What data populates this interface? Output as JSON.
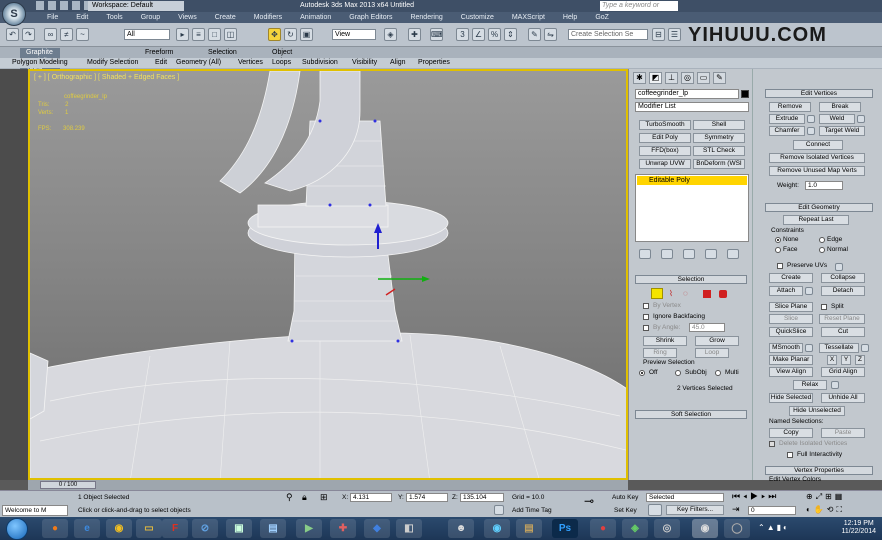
{
  "titlebar": {
    "workspace": "Workspace: Default",
    "title": "Autodesk 3ds Max 2013 x64      Untitled",
    "search_placeholder": "Type a keyword or phrase"
  },
  "menu": [
    "File",
    "Edit",
    "Tools",
    "Group",
    "Views",
    "Create",
    "Modifiers",
    "Animation",
    "Graph Editors",
    "Rendering",
    "Customize",
    "MAXScript",
    "Help",
    "GoZ"
  ],
  "toolbar": {
    "filter": "All",
    "view": "View",
    "selection_set": "Create Selection Se",
    "brand": "YIHUUU.COM"
  },
  "ribbon": {
    "tabs": [
      "Graphite Modeling Tools",
      "Freeform",
      "Selection",
      "Object Paint"
    ],
    "sub": [
      "Polygon Modeling",
      "Modify Selection",
      "Edit",
      "Geometry (All)",
      "Vertices",
      "Loops",
      "Subdivision",
      "Visibility",
      "Align",
      "Properties"
    ]
  },
  "viewport": {
    "label": "[ + ] [ Orthographic ] [ Shaded + Edged Faces ]",
    "object": "coffeegrinder_lp",
    "tris_label": "Tris:",
    "tris": "2",
    "verts_label": "Verts:",
    "verts": "1",
    "fps_label": "FPS:",
    "fps": "308.239"
  },
  "command_panel": {
    "object_name": "coffeegrinder_lp",
    "modifier_list": "Modifier List",
    "mod_buttons": [
      "TurboSmooth",
      "Shell",
      "Edit Poly",
      "Symmetry",
      "FFD(box)",
      "STL Check",
      "Unwrap UVW",
      "BnDeform (WSI"
    ],
    "stack_item": "Editable Poly",
    "selection": {
      "header": "Selection",
      "by_vertex": "By Vertex",
      "ignore_backfacing": "Ignore Backfacing",
      "by_angle": "By Angle:",
      "angle_val": "45.0",
      "shrink": "Shrink",
      "grow": "Grow",
      "ring": "Ring",
      "loop": "Loop",
      "preview": "Preview Selection",
      "off": "Off",
      "subobj": "SubObj",
      "multi": "Multi",
      "status": "2 Vertices Selected"
    },
    "soft_selection": "Soft Selection"
  },
  "edit_vertices": {
    "header": "Edit Vertices",
    "remove": "Remove",
    "break": "Break",
    "extrude": "Extrude",
    "weld": "Weld",
    "chamfer": "Chamfer",
    "target_weld": "Target Weld",
    "connect": "Connect",
    "remove_isolated": "Remove Isolated Vertices",
    "remove_unused": "Remove Unused Map Verts",
    "weight_label": "Weight:",
    "weight": "1.0"
  },
  "edit_geometry": {
    "header": "Edit Geometry",
    "repeat_last": "Repeat Last",
    "constraints": "Constraints",
    "none": "None",
    "edge": "Edge",
    "face": "Face",
    "normal": "Normal",
    "preserve_uvs": "Preserve UVs",
    "create": "Create",
    "collapse": "Collapse",
    "attach": "Attach",
    "detach": "Detach",
    "slice_plane": "Slice Plane",
    "split": "Split",
    "slice": "Slice",
    "reset_plane": "Reset Plane",
    "quickslice": "QuickSlice",
    "cut": "Cut",
    "msmooth": "MSmooth",
    "tessellate": "Tessellate",
    "make_planar": "Make Planar",
    "x": "X",
    "y": "Y",
    "z": "Z",
    "view_align": "View Align",
    "grid_align": "Grid Align",
    "relax": "Relax",
    "hide_selected": "Hide Selected",
    "unhide_all": "Unhide All",
    "hide_unselected": "Hide Unselected",
    "named_selections": "Named Selections:",
    "copy": "Copy",
    "paste": "Paste",
    "delete_isolated": "Delete Isolated Vertices",
    "full_interactivity": "Full Interactivity",
    "vertex_properties": "Vertex Properties",
    "edit_vertex_colors": "Edit Vertex Colors"
  },
  "timeline": {
    "slider": "0 / 100"
  },
  "status": {
    "welcome": "Welcome to M",
    "selected": "1 Object Selected",
    "prompt": "Click or click-and-drag to select objects",
    "x_label": "X:",
    "x": "4.131",
    "y_label": "Y:",
    "y": "1.574",
    "z_label": "Z:",
    "z": "135.104",
    "grid": "Grid = 10.0",
    "add_time_tag": "Add Time Tag",
    "auto_key": "Auto Key",
    "set_key": "Set Key",
    "selected_dd": "Selected",
    "key_filters": "Key Filters...",
    "frame": "0"
  },
  "clock": {
    "time": "12:19 PM",
    "date": "11/22/2014"
  },
  "colors": {
    "viewport_border": "#e0c000",
    "selection_yellow": "#ffd400"
  }
}
